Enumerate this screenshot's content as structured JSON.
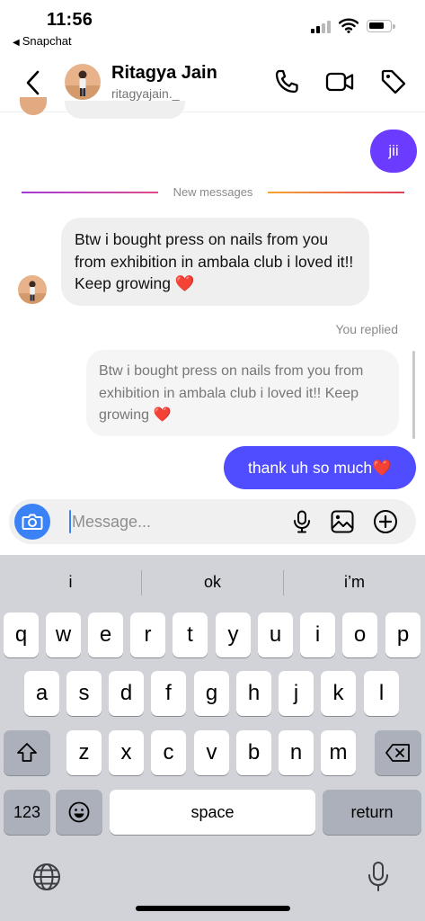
{
  "status_bar": {
    "time": "11:56",
    "back_app": "Snapchat"
  },
  "header": {
    "name": "Ritagya Jain",
    "username": "ritagyajain._"
  },
  "messages": {
    "outgoing_short": "jii",
    "divider_label": "New messages",
    "incoming_text": "Btw i bought press on nails from you from exhibition in ambala club i loved it!! Keep growing ❤️",
    "you_replied_label": "You replied",
    "replied_quote": "Btw i bought press on nails from you from exhibition in ambala club i loved it!! Keep growing ❤️",
    "outgoing_reply": "thank uh so much❤️"
  },
  "composer": {
    "placeholder": "Message..."
  },
  "keyboard": {
    "suggestions": [
      "i",
      "ok",
      "i’m"
    ],
    "row1": [
      "q",
      "w",
      "e",
      "r",
      "t",
      "y",
      "u",
      "i",
      "o",
      "p"
    ],
    "row2": [
      "a",
      "s",
      "d",
      "f",
      "g",
      "h",
      "j",
      "k",
      "l"
    ],
    "row3": [
      "z",
      "x",
      "c",
      "v",
      "b",
      "n",
      "m"
    ],
    "numbers_key": "123",
    "space_key": "space",
    "return_key": "return"
  },
  "colors": {
    "accent_purple": "#6b3bff",
    "accent_blue": "#4f4dff",
    "camera_blue": "#3b82f6",
    "bubble_gray": "#efefef",
    "keyboard_bg": "#d1d3d9"
  },
  "icons": {
    "header": [
      "back-chevron-icon",
      "phone-icon",
      "video-call-icon",
      "tag-icon"
    ],
    "composer": [
      "camera-icon",
      "microphone-icon",
      "gallery-icon",
      "add-circle-icon"
    ],
    "keyboard": [
      "shift-icon",
      "backspace-icon",
      "emoji-icon",
      "globe-icon",
      "dictation-mic-icon"
    ]
  }
}
